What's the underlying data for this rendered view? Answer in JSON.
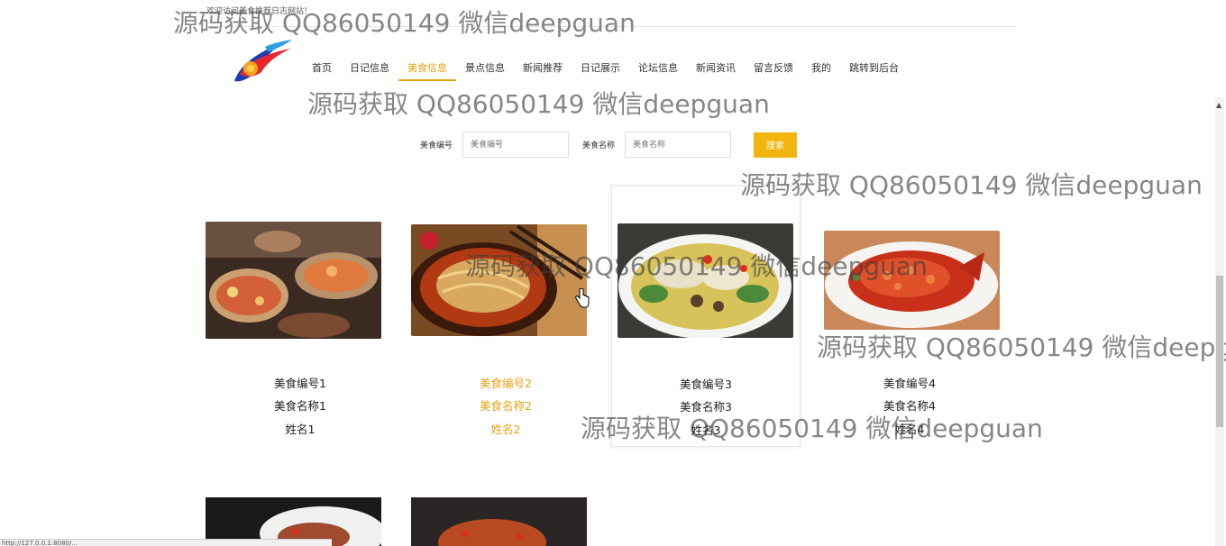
{
  "site": {
    "welcome": "欢迎访问美食推荐日志网站！"
  },
  "nav": {
    "items": [
      {
        "label": "首页"
      },
      {
        "label": "日记信息"
      },
      {
        "label": "美食信息"
      },
      {
        "label": "景点信息"
      },
      {
        "label": "新闻推荐"
      },
      {
        "label": "日记展示"
      },
      {
        "label": "论坛信息"
      },
      {
        "label": "新闻资讯"
      },
      {
        "label": "留言反馈"
      },
      {
        "label": "我的"
      },
      {
        "label": "跳转到后台"
      }
    ],
    "active_index": 2,
    "active_color": "#e8a317"
  },
  "search": {
    "code_label": "美食编号",
    "code_placeholder": "美食编号",
    "name_label": "美食名称",
    "name_placeholder": "美食名称",
    "button_label": "搜索",
    "button_color": "#f2b50f"
  },
  "cards": [
    {
      "code": "美食编号1",
      "name": "美食名称1",
      "person": "姓名1",
      "image": "seafood-platter-photo"
    },
    {
      "code": "美食编号2",
      "name": "美食名称2",
      "person": "姓名2",
      "image": "spicy-noodles-photo"
    },
    {
      "code": "美食编号3",
      "name": "美食名称3",
      "person": "姓名3",
      "image": "fish-soup-photo"
    },
    {
      "code": "美食编号4",
      "name": "美食名称4",
      "person": "姓名4",
      "image": "squirrel-fish-photo"
    }
  ],
  "watermark": "源码获取 QQ86050149 微信deepguan",
  "status_url": "http://127.0.0.1:8080/..."
}
